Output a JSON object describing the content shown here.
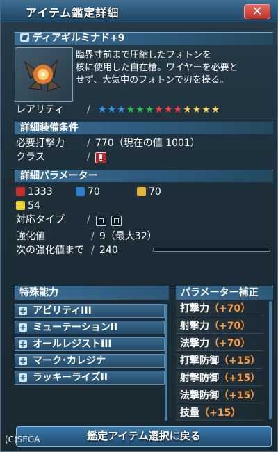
{
  "window": {
    "title": "アイテム鑑定詳細",
    "close_label": "✕"
  },
  "weapon": {
    "name": "ディアギルミナド+9",
    "description": "臨界寸前まで圧縮したフォトンを\n核に使用した自在槍。ワイヤーを必要と\nせず、大気中のフォトンで刃を操る。",
    "rarity_label": "レアリティ",
    "rarity_stars": 13,
    "rarity_colors": [
      "#2a9cf6",
      "#2a9cf6",
      "#2a9cf6",
      "#22c44a",
      "#22c44a",
      "#22c44a",
      "#ff3d3d",
      "#ff3d3d",
      "#ff3d3d",
      "#ffd35a",
      "#ffd35a",
      "#ffd35a",
      "#ffd35a"
    ]
  },
  "equip_conditions": {
    "header": "詳細装備条件",
    "required_attack_label": "必要打撃力",
    "required_attack_value": "770（現在の値 1001）",
    "class_label": "クラス"
  },
  "parameters": {
    "header": "詳細パラメーター",
    "melee": "1333",
    "ranged": "70",
    "tech": "70",
    "pp": "54",
    "compatible_type_label": "対応タイプ",
    "grind_label": "強化値",
    "grind_value": "9（最大32）",
    "next_grind_label": "次の強化値まで",
    "next_grind_value": "240",
    "next_grind_progress": 0.0
  },
  "special_abilities": {
    "header": "特殊能力",
    "items": [
      "アビリティIII",
      "ミューテーションII",
      "オールレジストIII",
      "マーク･カレジナ",
      "ラッキーライズII"
    ]
  },
  "param_correction": {
    "header": "パラメーター補正",
    "items": [
      {
        "label": "打撃力",
        "value": "（+70）"
      },
      {
        "label": "射撃力",
        "value": "（+70）"
      },
      {
        "label": "法撃力",
        "value": "（+70）"
      },
      {
        "label": "打撃防御",
        "value": "（+15）"
      },
      {
        "label": "射撃防御",
        "value": "（+15）"
      },
      {
        "label": "法撃防御",
        "value": "（+15）"
      },
      {
        "label": "技量",
        "value": "（+15）"
      }
    ]
  },
  "footer": {
    "back_button": "鑑定アイテム選択に戻る",
    "copyright": "(C)SEGA"
  }
}
